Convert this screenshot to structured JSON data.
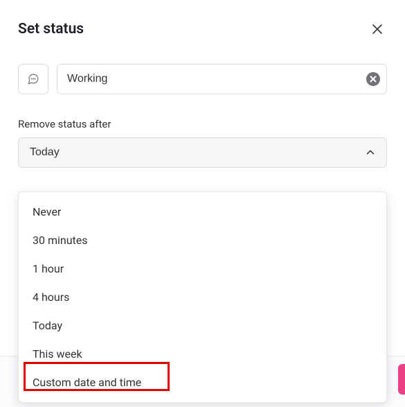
{
  "title": "Set status",
  "status": {
    "value": "Working"
  },
  "remove": {
    "label": "Remove status after",
    "selected": "Today",
    "options": [
      "Never",
      "30 minutes",
      "1 hour",
      "4 hours",
      "Today",
      "This week",
      "Custom date and time"
    ]
  }
}
